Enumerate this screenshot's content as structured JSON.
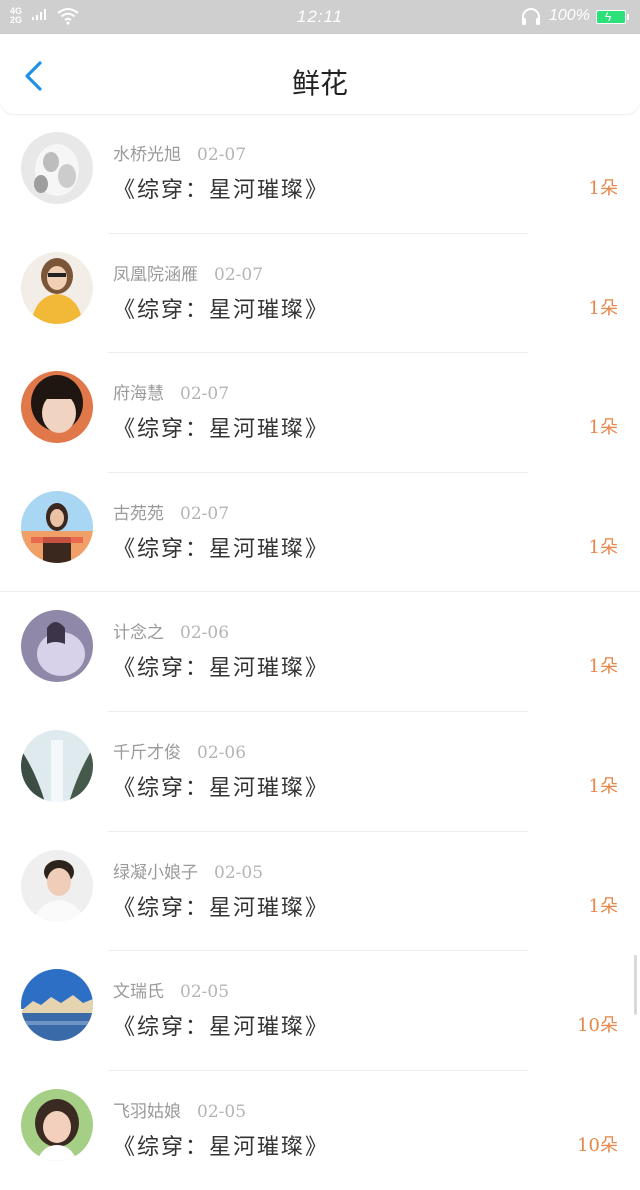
{
  "status_bar": {
    "network_top": "4G",
    "network_bottom": "2G",
    "time": "12:11",
    "battery": "100%"
  },
  "header": {
    "title": "鲜花"
  },
  "items": [
    {
      "name": "水桥光旭",
      "date": "02-07",
      "book": "《综穿：星河璀璨》",
      "count": "1朵",
      "avatar_colors": [
        "#e9e9e9",
        "#b9b9b9"
      ]
    },
    {
      "name": "凤凰院涵雁",
      "date": "02-07",
      "book": "《综穿：星河璀璨》",
      "count": "1朵",
      "avatar_colors": [
        "#f3c24c",
        "#9a6a3f"
      ]
    },
    {
      "name": "府海慧",
      "date": "02-07",
      "book": "《综穿：星河璀璨》",
      "count": "1朵",
      "avatar_colors": [
        "#e5b8a4",
        "#2b1d18"
      ]
    },
    {
      "name": "古苑苑",
      "date": "02-07",
      "book": "《综穿：星河璀璨》",
      "count": "1朵",
      "avatar_colors": [
        "#9dcff0",
        "#e38b4e"
      ]
    },
    {
      "name": "计念之",
      "date": "02-06",
      "book": "《综穿：星河璀璨》",
      "count": "1朵",
      "avatar_colors": [
        "#c9c2dc",
        "#6b6480"
      ]
    },
    {
      "name": "千斤才俊",
      "date": "02-06",
      "book": "《综穿：星河璀璨》",
      "count": "1朵",
      "avatar_colors": [
        "#d6e4ea",
        "#3d4f46"
      ]
    },
    {
      "name": "绿凝小娘子",
      "date": "02-05",
      "book": "《综穿：星河璀璨》",
      "count": "1朵",
      "avatar_colors": [
        "#ededed",
        "#3a3028"
      ]
    },
    {
      "name": "文瑞氏",
      "date": "02-05",
      "book": "《综穿：星河璀璨》",
      "count": "10朵",
      "avatar_colors": [
        "#2f6cc0",
        "#d9b88c"
      ]
    },
    {
      "name": "飞羽姑娘",
      "date": "02-05",
      "book": "《综穿：星河璀璨》",
      "count": "10朵",
      "avatar_colors": [
        "#a8cf8c",
        "#3b2a22"
      ]
    }
  ],
  "colors": {
    "accent_back": "#1e90e6",
    "count": "#e7874a",
    "status_bar_bg": "#cfcfcf"
  }
}
